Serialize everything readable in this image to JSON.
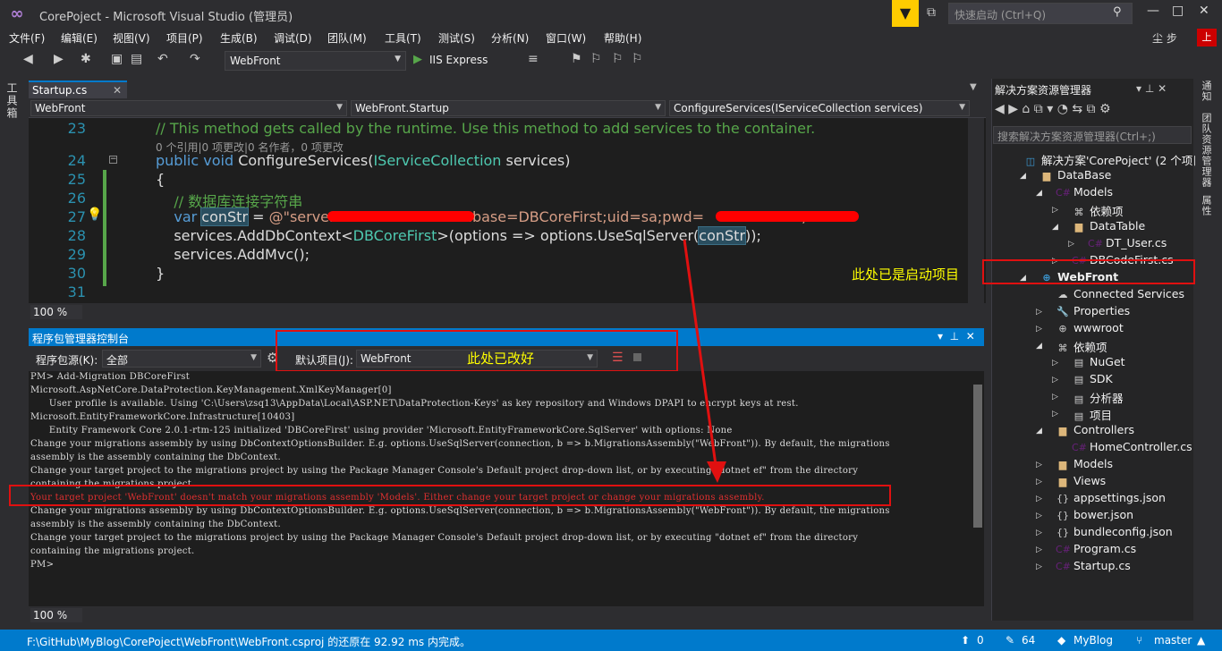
{
  "window": {
    "title": "CorePoject - Microsoft Visual Studio (管理员)",
    "quick_launch": "快速启动 (Ctrl+Q)",
    "user": "尘 步",
    "user_badge": "上"
  },
  "menu": [
    "文件(F)",
    "编辑(E)",
    "视图(V)",
    "项目(P)",
    "生成(B)",
    "调试(D)",
    "团队(M)",
    "工具(T)",
    "测试(S)",
    "分析(N)",
    "窗口(W)",
    "帮助(H)"
  ],
  "toolbar": {
    "config": "WebFront",
    "run": "IIS Express"
  },
  "left_toolbox": "工具箱",
  "editor": {
    "tab": "Startup.cs",
    "nav": [
      "WebFront",
      "WebFront.Startup",
      "ConfigureServices(IServiceCollection services)"
    ],
    "lines": [
      {
        "n": "23",
        "parts": [
          {
            "t": "// This method gets called by the runtime. Use this method to add services to the container.",
            "c": "cm"
          }
        ]
      },
      {
        "n": "",
        "lens": "0 个引用|0 项更改|0 名作者，0 项更改"
      },
      {
        "n": "24",
        "parts": [
          {
            "t": "public ",
            "c": "kw"
          },
          {
            "t": "void ",
            "c": "kw"
          },
          {
            "t": "ConfigureServices(",
            "c": ""
          },
          {
            "t": "IServiceCollection",
            "c": "ty"
          },
          {
            "t": " services)",
            "c": ""
          }
        ]
      },
      {
        "n": "25",
        "parts": [
          {
            "t": "{",
            "c": ""
          }
        ]
      },
      {
        "n": "26",
        "parts": [
          {
            "t": "    // 数据库连接字符串",
            "c": "cm"
          }
        ]
      },
      {
        "n": "27",
        "parts": [
          {
            "t": "    ",
            "c": ""
          },
          {
            "t": "var ",
            "c": "kw"
          },
          {
            "t": "conStr",
            "c": "hl"
          },
          {
            "t": " = ",
            "c": ""
          },
          {
            "t": "@\"server=",
            "c": "st"
          },
          {
            "t": "                    ",
            "c": "st"
          },
          {
            "t": "Database=DBCoreFirst;uid=sa;pwd=",
            "c": "st"
          },
          {
            "t": "                    ",
            "c": "st"
          },
          {
            "t": "\";",
            "c": "st"
          }
        ]
      },
      {
        "n": "28",
        "parts": [
          {
            "t": "    services.AddDbContext<",
            "c": ""
          },
          {
            "t": "DBCoreFirst",
            "c": "ty"
          },
          {
            "t": ">(options => options.UseSqlServer(",
            "c": ""
          },
          {
            "t": "conStr",
            "c": "hl"
          },
          {
            "t": "));",
            "c": ""
          }
        ]
      },
      {
        "n": "29",
        "parts": [
          {
            "t": "    services.AddMvc();",
            "c": ""
          }
        ]
      },
      {
        "n": "30",
        "parts": [
          {
            "t": "}",
            "c": ""
          }
        ]
      },
      {
        "n": "31",
        "parts": []
      }
    ],
    "zoom": "100 %"
  },
  "pmc": {
    "title": "程序包管理器控制台",
    "source_label": "程序包源(K):",
    "source": "全部",
    "default_label": "默认项目(J):",
    "default_project": "WebFront",
    "annotation": "此处已改好",
    "lines": [
      {
        "t": "PM> Add-Migration DBCoreFirst",
        "err": false
      },
      {
        "t": "Microsoft.AspNetCore.DataProtection.KeyManagement.XmlKeyManager[0]",
        "err": false
      },
      {
        "t": "      User profile is available. Using 'C:\\Users\\zsq13\\AppData\\Local\\ASP.NET\\DataProtection-Keys' as key repository and Windows DPAPI to encrypt keys at rest.",
        "err": false
      },
      {
        "t": "Microsoft.EntityFrameworkCore.Infrastructure[10403]",
        "err": false
      },
      {
        "t": "      Entity Framework Core 2.0.1-rtm-125 initialized 'DBCoreFirst' using provider 'Microsoft.EntityFrameworkCore.SqlServer' with options: None",
        "err": false
      },
      {
        "t": "Change your migrations assembly by using DbContextOptionsBuilder. E.g. options.UseSqlServer(connection, b => b.MigrationsAssembly(\"WebFront\")). By default, the migrations",
        "err": false
      },
      {
        "t": "assembly is the assembly containing the DbContext.",
        "err": false
      },
      {
        "t": "Change your target project to the migrations project by using the Package Manager Console's Default project drop-down list, or by executing \"dotnet ef\" from the directory",
        "err": false
      },
      {
        "t": "containing the migrations project.",
        "err": false
      },
      {
        "t": "Your target project 'WebFront' doesn't match your migrations assembly 'Models'. Either change your target project or change your migrations assembly.",
        "err": true
      },
      {
        "t": "Change your migrations assembly by using DbContextOptionsBuilder. E.g. options.UseSqlServer(connection, b => b.MigrationsAssembly(\"WebFront\")). By default, the migrations",
        "err": false
      },
      {
        "t": "assembly is the assembly containing the DbContext.",
        "err": false
      },
      {
        "t": "Change your target project to the migrations project by using the Package Manager Console's Default project drop-down list, or by executing \"dotnet ef\" from the directory",
        "err": false
      },
      {
        "t": "containing the migrations project.",
        "err": false
      },
      {
        "t": "PM>",
        "err": false
      }
    ],
    "zoom": "100 %"
  },
  "solution_explorer": {
    "title": "解决方案资源管理器",
    "search": "搜索解决方案资源管理器(Ctrl+;)",
    "annotation": "此处已是启动项目",
    "items": [
      {
        "label": "解决方案'CorePoject' (2 个项目)",
        "icon": "solution-icon",
        "depth": 0,
        "tw": ""
      },
      {
        "label": "DataBase",
        "icon": "folder-icon",
        "depth": 1,
        "tw": "◢"
      },
      {
        "label": "Models",
        "icon": "csharp-project-icon",
        "depth": 2,
        "tw": "◢"
      },
      {
        "label": "依赖项",
        "icon": "references-icon",
        "depth": 3,
        "tw": "▷"
      },
      {
        "label": "DataTable",
        "icon": "folder-icon",
        "depth": 3,
        "tw": "◢"
      },
      {
        "label": "DT_User.cs",
        "icon": "csharp-file-icon",
        "depth": 4,
        "tw": "▷"
      },
      {
        "label": "DBCodeFirst.cs",
        "icon": "csharp-file-icon",
        "depth": 3,
        "tw": "▷"
      },
      {
        "label": "WebFront",
        "icon": "web-project-icon",
        "depth": 1,
        "tw": "◢",
        "bold": true
      },
      {
        "label": "Connected Services",
        "icon": "connected-services-icon",
        "depth": 2,
        "tw": ""
      },
      {
        "label": "Properties",
        "icon": "properties-icon",
        "depth": 2,
        "tw": "▷"
      },
      {
        "label": "wwwroot",
        "icon": "globe-icon",
        "depth": 2,
        "tw": "▷"
      },
      {
        "label": "依赖项",
        "icon": "references-icon",
        "depth": 2,
        "tw": "◢"
      },
      {
        "label": "NuGet",
        "icon": "nuget-icon",
        "depth": 3,
        "tw": "▷"
      },
      {
        "label": "SDK",
        "icon": "sdk-icon",
        "depth": 3,
        "tw": "▷"
      },
      {
        "label": "分析器",
        "icon": "analyzer-icon",
        "depth": 3,
        "tw": "▷"
      },
      {
        "label": "项目",
        "icon": "project-ref-icon",
        "depth": 3,
        "tw": "▷"
      },
      {
        "label": "Controllers",
        "icon": "folder-icon",
        "depth": 2,
        "tw": "◢"
      },
      {
        "label": "HomeController.cs",
        "icon": "csharp-file-icon",
        "depth": 3,
        "tw": ""
      },
      {
        "label": "Models",
        "icon": "folder-icon",
        "depth": 2,
        "tw": "▷"
      },
      {
        "label": "Views",
        "icon": "folder-icon",
        "depth": 2,
        "tw": "▷"
      },
      {
        "label": "appsettings.json",
        "icon": "json-file-icon",
        "depth": 2,
        "tw": "▷"
      },
      {
        "label": "bower.json",
        "icon": "json-file-icon",
        "depth": 2,
        "tw": "▷"
      },
      {
        "label": "bundleconfig.json",
        "icon": "json-file-icon",
        "depth": 2,
        "tw": "▷"
      },
      {
        "label": "Program.cs",
        "icon": "csharp-file-icon",
        "depth": 2,
        "tw": "▷"
      },
      {
        "label": "Startup.cs",
        "icon": "csharp-file-icon",
        "depth": 2,
        "tw": "▷"
      }
    ]
  },
  "right_tabs": [
    "通知",
    "团队资源管理器",
    "属性"
  ],
  "status": {
    "message": "F:\\GitHub\\MyBlog\\CorePoject\\WebFront\\WebFront.csproj 的还原在 92.92 ms 内完成。",
    "up": "0",
    "edits": "64",
    "repo": "MyBlog",
    "branch": "master"
  },
  "colors": {
    "accent": "#007acc",
    "annotation": "#ffff00",
    "highlight_box": "#e01010"
  }
}
